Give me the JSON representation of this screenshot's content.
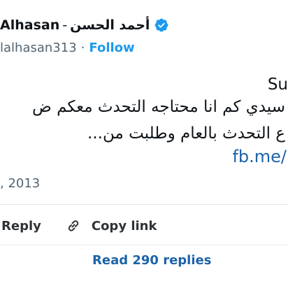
{
  "author": {
    "name_latin": "Alhasan",
    "separator": "-",
    "name_arabic": "أحمد الحسن",
    "handle": "lalhasan313",
    "handle_dot": "·",
    "follow_label": "Follow",
    "verified_icon": "verified-badge-icon",
    "verified_color": "#1d9bf0"
  },
  "tweet": {
    "line1": "Su",
    "line2": "سيدي كم انا محتاجه التحدث معكم ض",
    "line3": "ع التحدث بالعام وطلبت من...",
    "link": "fb.me/"
  },
  "date": ", 2013",
  "actions": {
    "reply_label": "Reply",
    "copy_label": "Copy link",
    "link_icon": "link-icon"
  },
  "read_replies_label": "Read 290 replies",
  "colors": {
    "accent": "#1d9bf0",
    "link": "#1d63a8",
    "muted": "#536471"
  }
}
